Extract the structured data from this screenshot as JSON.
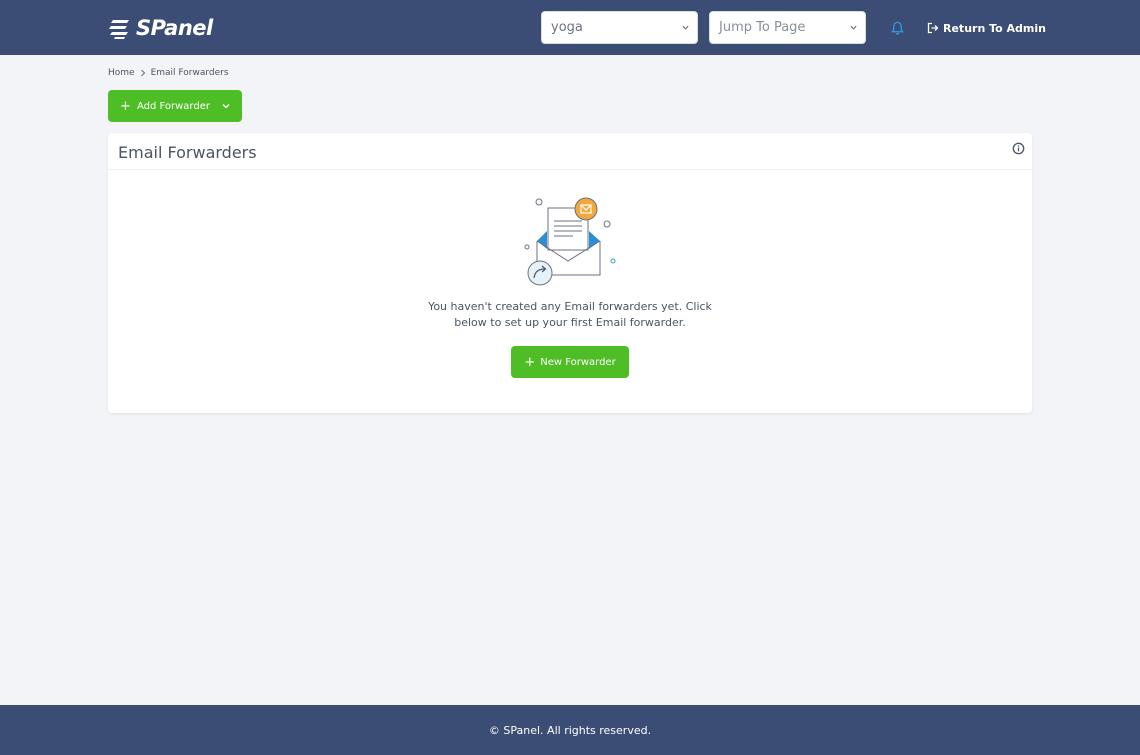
{
  "header": {
    "logo_text": "SPanel",
    "site_select": {
      "value": "yoga"
    },
    "jump_select": {
      "value": "Jump To Page"
    },
    "return_link": "Return To Admin"
  },
  "breadcrumb": {
    "home": "Home",
    "current": "Email Forwarders"
  },
  "toolbar": {
    "add_label": "Add Forwarder",
    "add_plus": "+"
  },
  "card": {
    "title": "Email Forwarders",
    "empty_line1": "You haven't created any Email forwarders yet. Click",
    "empty_line2": "below to set up your first Email forwarder.",
    "new_label": "New Forwarder",
    "new_plus": "+"
  },
  "footer": {
    "text": "© SPanel. All rights reserved."
  },
  "colors": {
    "header_bg": "#3b4d75",
    "accent_green": "#4fbe26",
    "bell_blue": "#2f9be8",
    "page_bg": "#f3f4f7"
  },
  "icons": {
    "logo": "spanel-logo-icon",
    "bell": "bell-icon",
    "return": "sign-out-icon",
    "info": "info-icon",
    "chevron": "chevron-down-icon",
    "illustration": "envelope-illustration-icon"
  }
}
